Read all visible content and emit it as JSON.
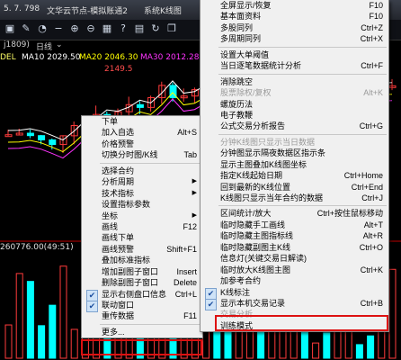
{
  "titlebar": {
    "left_text": "5. 7. 798",
    "app_title": "文华云节点-模拟账通2",
    "window_title": "系统K线图"
  },
  "infobar": {
    "code": "j1809)",
    "period": "日线",
    "dropdown_arrow": "⌄"
  },
  "ma_bar": {
    "prefix": "DEL",
    "ma10": "MA10 2029.50",
    "ma20": "MA20 2046.30",
    "ma30": "MA30 2012.28"
  },
  "price_label": "2149.5",
  "lower_info": "260776.00(49:51)",
  "colors": {
    "ma10": "#ffffff",
    "ma20": "#ffff00",
    "ma30": "#ff33ff",
    "up": "#ff3b3b",
    "down": "#00ffff",
    "highlight": "#dd1111"
  },
  "left_menu": {
    "items": [
      {
        "label": "下单",
        "shortcut": "",
        "arrow": false,
        "checked": false,
        "disabled": false
      },
      {
        "label": "加入自选",
        "shortcut": "Alt+S",
        "arrow": false,
        "checked": false,
        "disabled": false
      },
      {
        "label": "价格预警",
        "shortcut": "",
        "arrow": false,
        "checked": false,
        "disabled": false
      },
      {
        "label": "切换分时图/K线",
        "shortcut": "Tab",
        "arrow": false,
        "checked": false,
        "disabled": false
      },
      {
        "sep": true
      },
      {
        "label": "选择合约",
        "shortcut": "",
        "arrow": false,
        "checked": false,
        "disabled": false
      },
      {
        "label": "分析周期",
        "shortcut": "",
        "arrow": true,
        "checked": false,
        "disabled": false
      },
      {
        "label": "技术指标",
        "shortcut": "",
        "arrow": true,
        "checked": false,
        "disabled": false
      },
      {
        "label": "设置指标参数",
        "shortcut": "",
        "arrow": false,
        "checked": false,
        "disabled": false
      },
      {
        "label": "坐标",
        "shortcut": "",
        "arrow": true,
        "checked": false,
        "disabled": false
      },
      {
        "label": "画线",
        "shortcut": "F12",
        "arrow": false,
        "checked": false,
        "disabled": false
      },
      {
        "label": "画线下单",
        "shortcut": "",
        "arrow": false,
        "checked": false,
        "disabled": false
      },
      {
        "label": "画线预警",
        "shortcut": "Shift+F1",
        "arrow": false,
        "checked": false,
        "disabled": false
      },
      {
        "label": "叠加标准指标",
        "shortcut": "",
        "arrow": false,
        "checked": false,
        "disabled": false
      },
      {
        "label": "增加副图子窗口",
        "shortcut": "Insert",
        "arrow": false,
        "checked": false,
        "disabled": false
      },
      {
        "label": "删除副图子窗口",
        "shortcut": "Delete",
        "arrow": false,
        "checked": false,
        "disabled": false
      },
      {
        "label": "显示右侧盘口信息",
        "shortcut": "Ctrl+L",
        "arrow": false,
        "checked": true,
        "disabled": false
      },
      {
        "label": "联动窗口",
        "shortcut": "",
        "arrow": false,
        "checked": true,
        "disabled": false
      },
      {
        "label": "重传数据",
        "shortcut": "F11",
        "arrow": false,
        "checked": false,
        "disabled": false
      },
      {
        "sep": true
      },
      {
        "label": "更多...",
        "shortcut": "",
        "arrow": false,
        "checked": false,
        "disabled": false
      }
    ]
  },
  "right_menu": {
    "items": [
      {
        "label": "全屏显示/恢复",
        "shortcut": "F10",
        "checked": false,
        "disabled": false
      },
      {
        "label": "基本面资料",
        "shortcut": "F10",
        "checked": false,
        "disabled": false
      },
      {
        "label": "多股同列",
        "shortcut": "Ctrl+Z",
        "checked": false,
        "disabled": false
      },
      {
        "label": "多周期同列",
        "shortcut": "Ctrl+X",
        "checked": false,
        "disabled": false
      },
      {
        "sep": true
      },
      {
        "label": "设置大单阈值",
        "shortcut": "",
        "checked": false,
        "disabled": false
      },
      {
        "label": "当日逐笔数据统计分析",
        "shortcut": "Ctrl+F",
        "checked": false,
        "disabled": false
      },
      {
        "sep": true
      },
      {
        "label": "消除跳空",
        "shortcut": "",
        "checked": false,
        "disabled": false
      },
      {
        "label": "股票除权/复权",
        "shortcut": "Alt+K",
        "checked": false,
        "disabled": true
      },
      {
        "label": "螺旋历法",
        "shortcut": "",
        "checked": false,
        "disabled": false
      },
      {
        "label": "电子教鞭",
        "shortcut": "",
        "checked": false,
        "disabled": false
      },
      {
        "label": "公式交易分析报告",
        "shortcut": "Ctrl+G",
        "checked": false,
        "disabled": false
      },
      {
        "sep": true
      },
      {
        "label": "分钟K线图只显示当日数据",
        "shortcut": "",
        "checked": false,
        "disabled": true
      },
      {
        "label": "分钟图显示隔夜数据区指示条",
        "shortcut": "",
        "checked": false,
        "disabled": false
      },
      {
        "label": "显示主图叠加K线图坐标",
        "shortcut": "",
        "checked": false,
        "disabled": false
      },
      {
        "label": "指定K线起始日期",
        "shortcut": "Ctrl+Home",
        "checked": false,
        "disabled": false
      },
      {
        "label": "回到最新的K线位置",
        "shortcut": "Ctrl+End",
        "checked": false,
        "disabled": false
      },
      {
        "label": "K线图只显示当年合约的数据",
        "shortcut": "Ctrl+J",
        "checked": false,
        "disabled": false
      },
      {
        "sep": true
      },
      {
        "label": "区间统计/放大",
        "shortcut": "Ctrl+按住鼠标移动",
        "checked": false,
        "disabled": false
      },
      {
        "label": "临时隐藏手工画线",
        "shortcut": "Alt+T",
        "checked": false,
        "disabled": false
      },
      {
        "label": "临时隐藏主图指标线",
        "shortcut": "Alt+R",
        "checked": false,
        "disabled": false
      },
      {
        "label": "临时隐藏副图主K线",
        "shortcut": "Ctrl+O",
        "checked": false,
        "disabled": false
      },
      {
        "label": "信息灯(关键交易日解读)",
        "shortcut": "",
        "checked": false,
        "disabled": false
      },
      {
        "label": "临时放大K线图主图",
        "shortcut": "Ctrl+K",
        "checked": false,
        "disabled": false
      },
      {
        "label": "加参考合约",
        "shortcut": "",
        "checked": false,
        "disabled": false
      },
      {
        "label": "K线标注",
        "shortcut": "",
        "checked": true,
        "disabled": false
      },
      {
        "label": "显示本机交易记录",
        "shortcut": "Ctrl+B",
        "checked": true,
        "disabled": false
      },
      {
        "label": "交易分析",
        "shortcut": "",
        "checked": false,
        "disabled": true
      },
      {
        "label": "训练模式",
        "shortcut": "",
        "checked": false,
        "disabled": false
      }
    ]
  },
  "toolbar_icons": [
    "save-icon",
    "edit-icon",
    "clock-icon",
    "minus-icon",
    "zoom-in-icon",
    "zoom-out-icon",
    "chart-icon",
    "help-icon",
    "grid-icon",
    "refresh-icon",
    "window-icon"
  ]
}
